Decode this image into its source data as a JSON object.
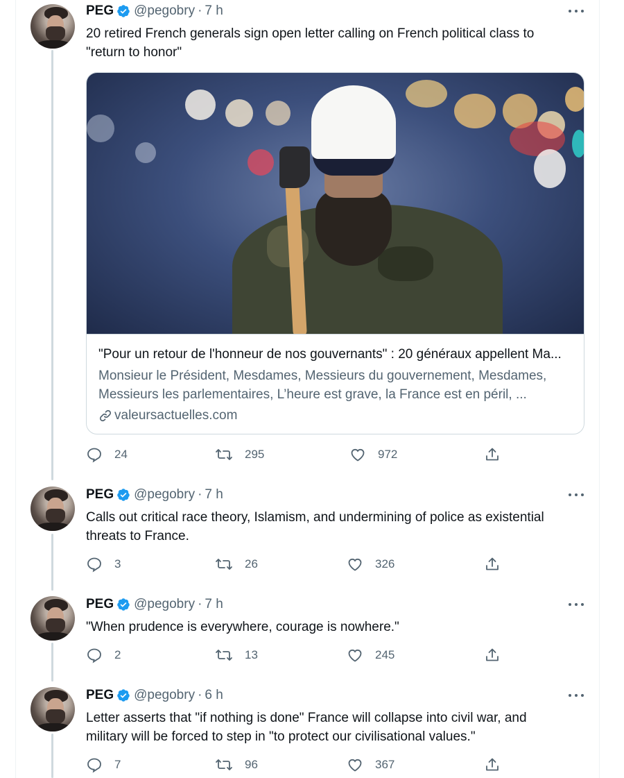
{
  "colors": {
    "text": "#0f1419",
    "secondary": "#536471",
    "verified": "#1d9bf0",
    "border": "#cfd9de"
  },
  "icons": {
    "verified": "verified-badge-icon",
    "more": "more-dots-icon",
    "reply": "reply-icon",
    "retweet": "retweet-icon",
    "like": "heart-icon",
    "share": "share-icon",
    "link": "link-icon"
  },
  "tweets": [
    {
      "name": "PEG",
      "handle": "@pegobry",
      "separator": "·",
      "time": "7 h",
      "text": "20 retired French generals sign open letter calling on French political class to \"return to honor\"",
      "card": {
        "title": "\"Pour un retour de l'honneur de nos gouvernants\" : 20 généraux appellent Ma...",
        "description": "Monsieur le Président, Mesdames, Messieurs du gouvernement, Mesdames, Messieurs les parlementaires, L’heure est grave, la France est en péril, ...",
        "domain": "valeursactuelles.com"
      },
      "replies": "24",
      "retweets": "295",
      "likes": "972"
    },
    {
      "name": "PEG",
      "handle": "@pegobry",
      "separator": "·",
      "time": "7 h",
      "text": "Calls out critical race theory, Islamism, and undermining of police as existential threats to France.",
      "replies": "3",
      "retweets": "26",
      "likes": "326"
    },
    {
      "name": "PEG",
      "handle": "@pegobry",
      "separator": "·",
      "time": "7 h",
      "text": "\"When prudence is everywhere, courage is nowhere.\"",
      "replies": "2",
      "retweets": "13",
      "likes": "245"
    },
    {
      "name": "PEG",
      "handle": "@pegobry",
      "separator": "·",
      "time": "6 h",
      "text": "Letter asserts that \"if nothing is done\" France will collapse into civil war, and military will be forced to step in \"to protect our civilisational values.\"",
      "replies": "7",
      "retweets": "96",
      "likes": "367"
    }
  ]
}
